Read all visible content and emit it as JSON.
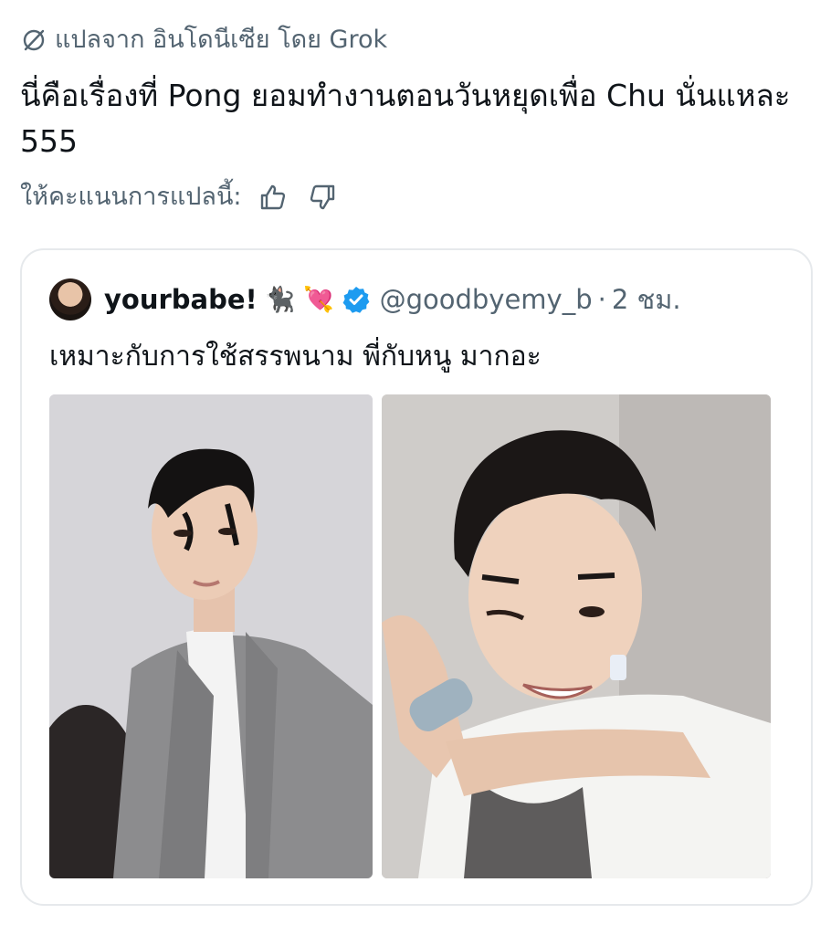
{
  "translation": {
    "label": "แปลจาก อินโดนีเซีย โดย Grok",
    "icon": "translate-icon"
  },
  "tweet": {
    "text": "นี่คือเรื่องที่ Pong ยอมทำงานตอนวันหยุดเพื่อ Chu นั่นแหละ 555"
  },
  "rating": {
    "label": "ให้คะแนนการแปลนี้:",
    "thumbs_up_icon": "thumbs-up-icon",
    "thumbs_down_icon": "thumbs-down-icon"
  },
  "quote": {
    "display_name": "yourbabe!",
    "emojis": "🐈‍⬛ 💘",
    "handle": "@goodbyemy_b",
    "separator": "·",
    "time": "2 ชม.",
    "text": "เหมาะกับการใช้สรรพนาม พี่กับหนู มากอะ",
    "verified_color": "#1d9bf0",
    "images": [
      {
        "name": "photo-man-grey-suit"
      },
      {
        "name": "photo-man-white-tshirt-wink"
      }
    ]
  },
  "colors": {
    "text_primary": "#0f1419",
    "text_secondary": "#536471",
    "border": "#e6e9ec"
  }
}
